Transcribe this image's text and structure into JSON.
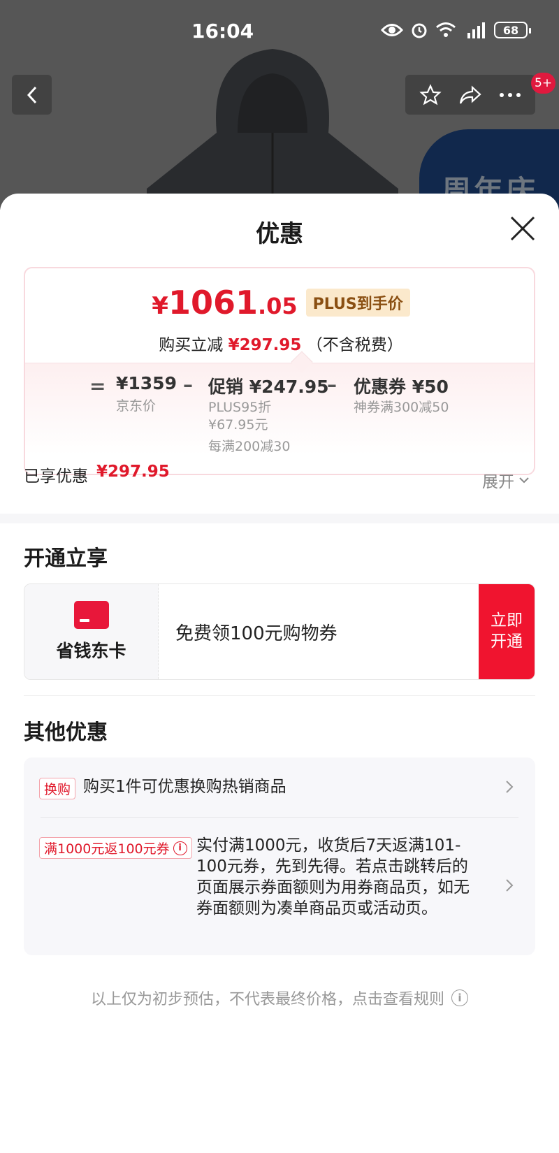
{
  "status_bar": {
    "time": "16:04",
    "battery": "68"
  },
  "background": {
    "promo_text": "周年庆",
    "message_badge": "5+"
  },
  "sheet": {
    "title": "优惠"
  },
  "price_card": {
    "currency": "¥",
    "final_price_int": "1061",
    "final_price_dec": ".05",
    "plus_label": "PLUS到手价",
    "save_prefix": "购买立减",
    "save_amount": "¥297.95",
    "save_suffix": "（不含税费）",
    "equals": "=",
    "minus": "–",
    "jd_price": "¥1359",
    "jd_price_label": "京东价",
    "promo_amount": "促销 ¥247.95",
    "promo_line1": "PLUS95折",
    "promo_line2": "¥67.95元",
    "promo_line3": "每满200减30",
    "coupon_amount": "优惠券 ¥50",
    "coupon_desc": "神券满300减50"
  },
  "enjoyed": {
    "label": "已享优惠",
    "amount": "¥297.95",
    "expand": "展开"
  },
  "open_section": {
    "title": "开通立享",
    "card_name": "省钱东卡",
    "card_desc": "免费领100元购物券",
    "button": "立即开通"
  },
  "other_section": {
    "title": "其他优惠",
    "offers": [
      {
        "tag": "换购",
        "text": "购买1件可优惠换购热销商品"
      },
      {
        "tag": "满1000元返100元券",
        "text": "实付满1000元，收货后7天返满101-100元券，先到先得。若点击跳转后的页面展示券面额则为用券商品页，如无券面额则为凑单商品页或活动页。"
      }
    ]
  },
  "footer": {
    "note": "以上仅为初步预估，不代表最终价格，点击查看规则"
  },
  "colors": {
    "accent_red": "#e0192b",
    "button_red": "#f0142f",
    "plus_gold_bg": "#fbe9cc"
  }
}
